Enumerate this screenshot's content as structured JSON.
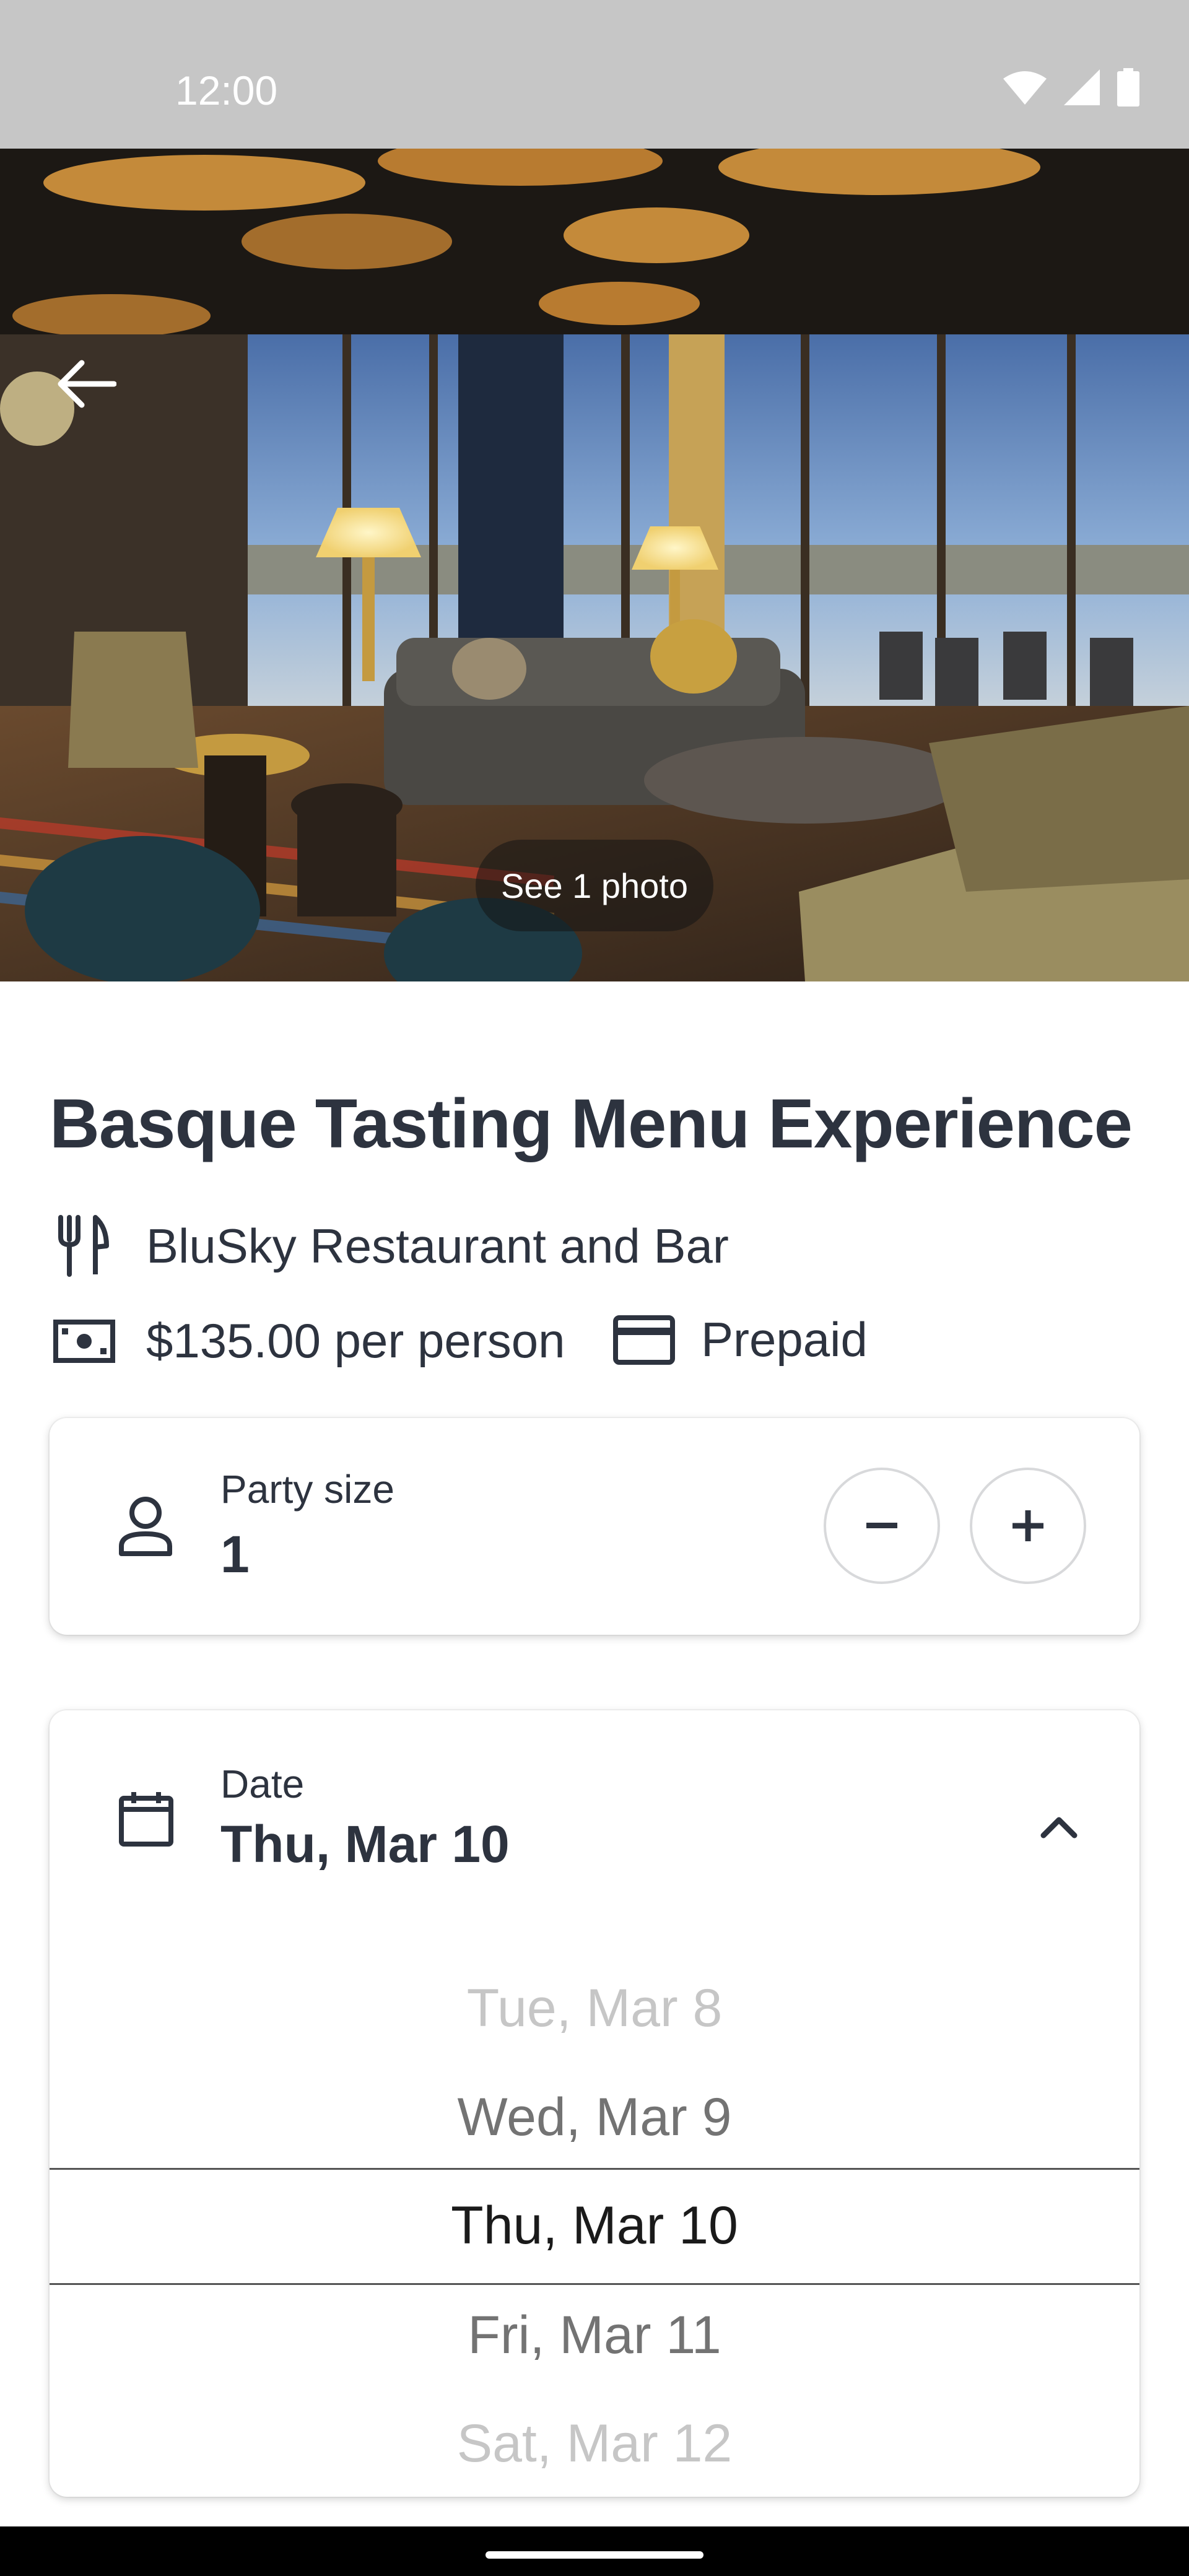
{
  "status_bar": {
    "time": "12:00",
    "icons": [
      "wifi-icon",
      "cell-signal-icon",
      "battery-icon"
    ]
  },
  "hero": {
    "photo_button_label": "See 1 photo"
  },
  "experience": {
    "title": "Basque Tasting Menu Experience",
    "restaurant": "BluSky Restaurant and Bar",
    "price": "$135.00 per person",
    "payment": "Prepaid"
  },
  "party_size": {
    "label": "Party size",
    "value": "1"
  },
  "date": {
    "label": "Date",
    "value": "Thu, Mar 10",
    "options": [
      "Tue, Mar 8",
      "Wed, Mar 9",
      "Thu, Mar 10",
      "Fri, Mar 11",
      "Sat, Mar 12"
    ],
    "selected_index": 2
  },
  "colors": {
    "text_primary": "#2d333f",
    "status_bar": "#c6c6c6",
    "nav_bar": "#000000"
  }
}
